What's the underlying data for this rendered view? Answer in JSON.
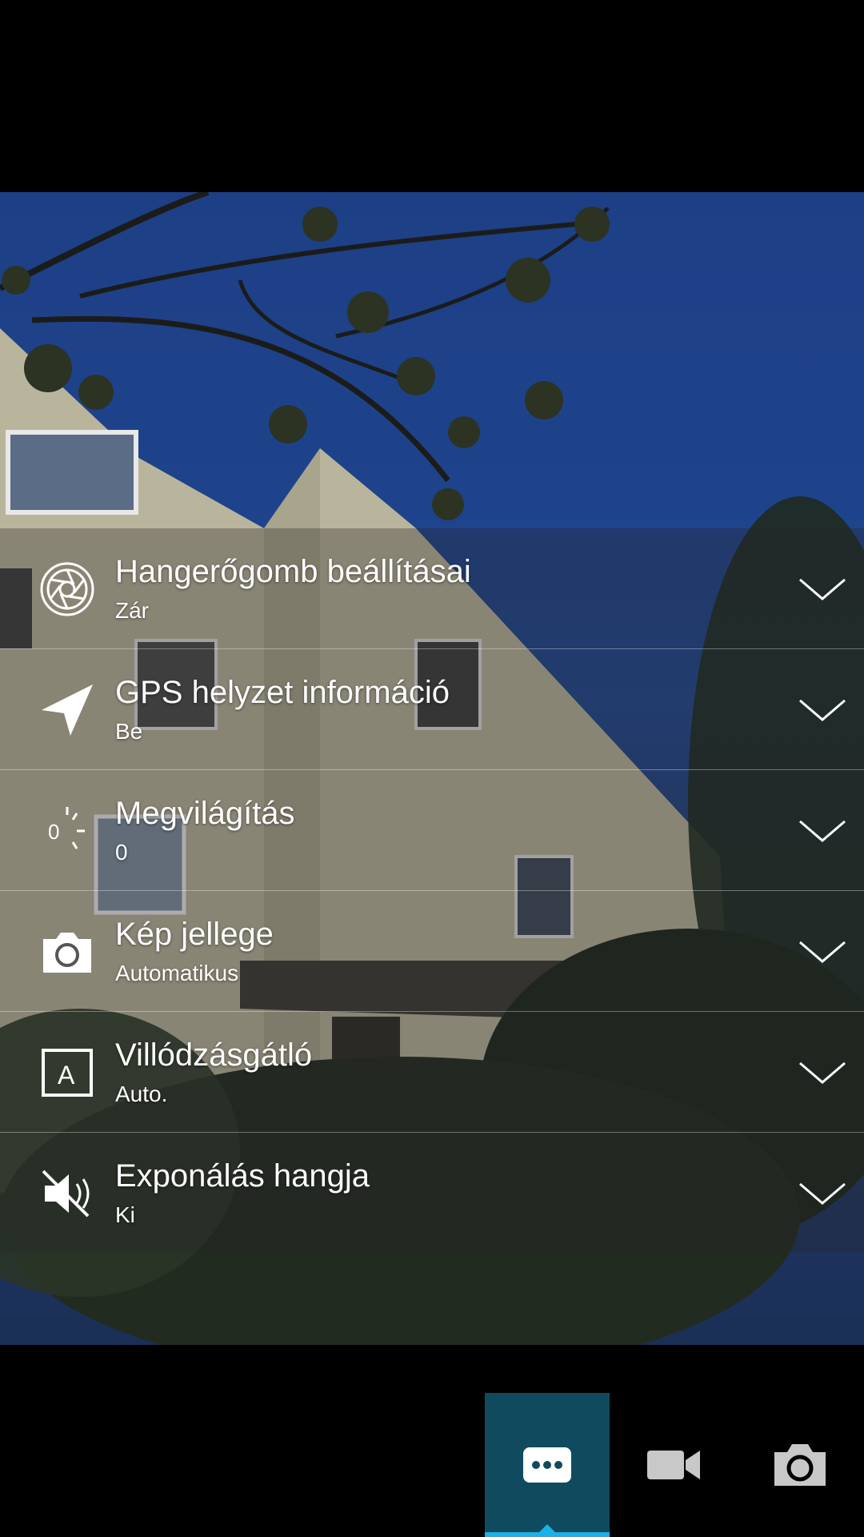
{
  "settings": {
    "items": [
      {
        "title": "Hangerőgomb beállításai",
        "value": "Zár",
        "icon": "aperture-icon"
      },
      {
        "title": "GPS helyzet információ",
        "value": "Be",
        "icon": "navigation-arrow-icon"
      },
      {
        "title": "Megvilágítás",
        "value": "0",
        "icon": "exposure-icon",
        "icon_text": "0"
      },
      {
        "title": "Kép jellege",
        "value": "Automatikus",
        "icon": "camera-icon"
      },
      {
        "title": "Villódzásgátló",
        "value": "Auto.",
        "icon": "anti-flicker-icon",
        "icon_text": "A"
      },
      {
        "title": "Exponálás hangja",
        "value": "Ki",
        "icon": "shutter-sound-off-icon"
      }
    ]
  },
  "bottom_bar": {
    "modes": [
      {
        "name": "settings-mode",
        "icon": "more-dots-icon",
        "active": true
      },
      {
        "name": "video-mode",
        "icon": "video-camera-icon",
        "active": false
      },
      {
        "name": "photo-mode",
        "icon": "camera-icon",
        "active": false
      }
    ]
  },
  "colors": {
    "active_mode_bg": "#0f4a5f",
    "active_indicator": "#1cb1e6",
    "icon_gray": "#c8c8c8"
  }
}
